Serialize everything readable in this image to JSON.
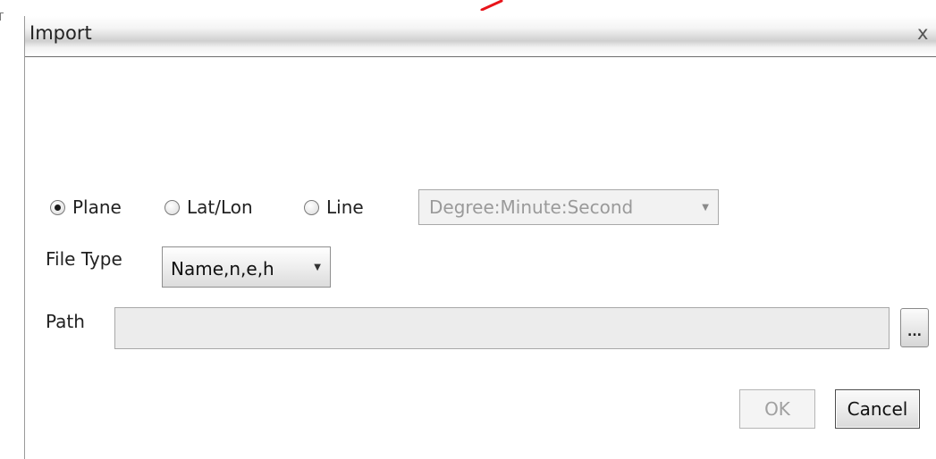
{
  "dialog": {
    "title": "Import",
    "close_glyph": "x"
  },
  "coordinate_mode": {
    "options": [
      {
        "label": "Plane",
        "checked": true
      },
      {
        "label": "Lat/Lon",
        "checked": false
      },
      {
        "label": "Line",
        "checked": false
      }
    ],
    "angle_format": {
      "value": "Degree:Minute:Second",
      "enabled": false
    }
  },
  "file_type": {
    "label": "File Type",
    "value": "Name,n,e,h"
  },
  "path": {
    "label": "Path",
    "value": "",
    "browse_label": "..."
  },
  "buttons": {
    "ok": "OK",
    "cancel": "Cancel"
  },
  "icons": {
    "dropdown": "chevron-down-icon",
    "close": "close-icon"
  },
  "colors": {
    "annotation": "#e8141a"
  }
}
